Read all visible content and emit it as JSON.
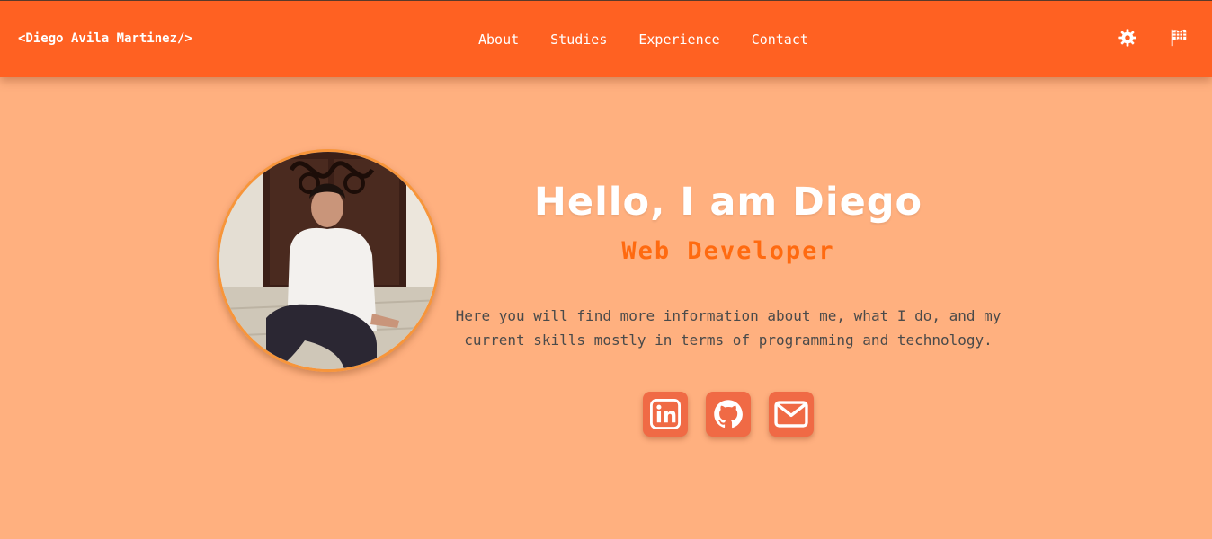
{
  "nav": {
    "brand": "<Diego Avila Martinez/>",
    "links": [
      {
        "label": "About"
      },
      {
        "label": "Studies"
      },
      {
        "label": "Experience"
      },
      {
        "label": "Contact"
      }
    ],
    "icons": [
      "settings-gear-icon",
      "language-flag-icon"
    ]
  },
  "hero": {
    "title": "Hello, I am Diego",
    "subtitle": "Web Developer",
    "description": "Here you will find more information about me, what I do, and my current skills mostly in terms of programming and technology.",
    "socials": [
      {
        "icon": "linkedin-icon"
      },
      {
        "icon": "github-icon"
      },
      {
        "icon": "email-icon"
      }
    ]
  },
  "colors": {
    "navbar": "#FF6122",
    "background": "#FFB07F",
    "accent": "#FF6A10",
    "social_button": "#F06A45",
    "avatar_border": "#F7953A"
  }
}
